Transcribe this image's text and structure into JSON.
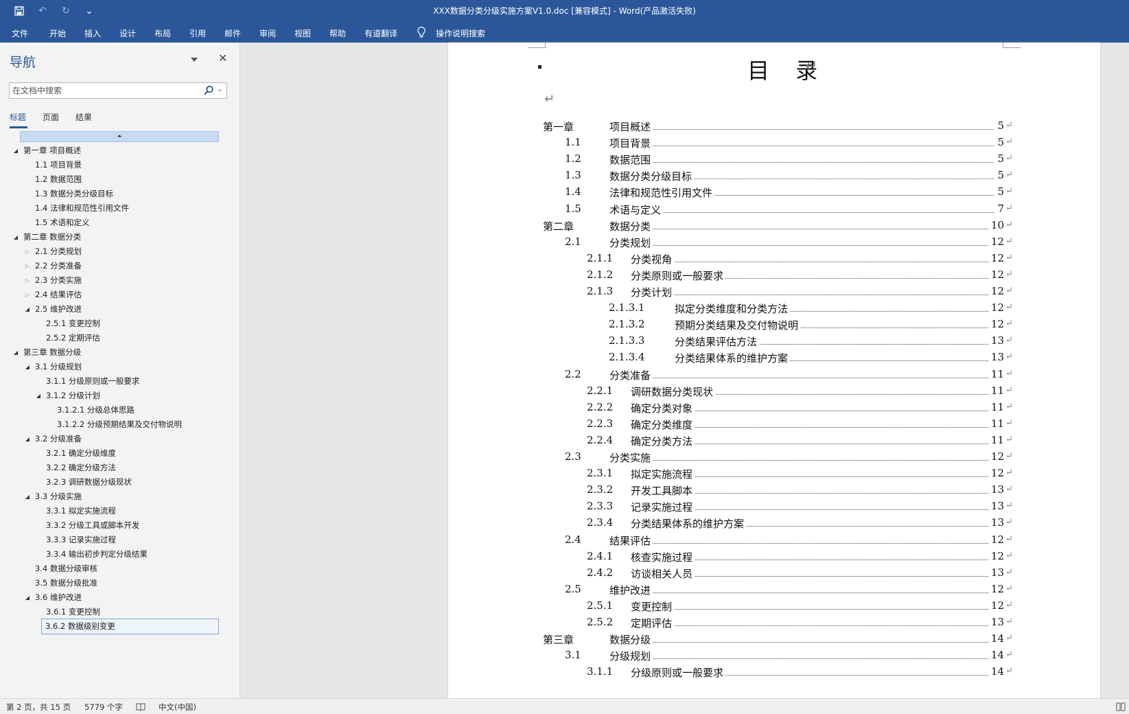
{
  "titlebar": {
    "title": "XXX数据分类分级实施方案V1.0.doc [兼容模式]  -  Word(产品激活失败)",
    "qat": {
      "save": "💾",
      "undo": "↶",
      "redo": "↻",
      "more": "⌄"
    }
  },
  "ribbon": {
    "tabs": [
      "文件",
      "开始",
      "插入",
      "设计",
      "布局",
      "引用",
      "邮件",
      "审阅",
      "视图",
      "帮助",
      "有道翻译"
    ],
    "tell_me": "操作说明搜索"
  },
  "nav": {
    "title": "导航",
    "close": "✕",
    "search_placeholder": "在文档中搜索",
    "tabs": [
      "标题",
      "页面",
      "结果"
    ],
    "collapse_glyph": "⏶",
    "items": [
      {
        "label": "第一章 项目概述",
        "level": 0,
        "toggle": "open"
      },
      {
        "label": "1.1 项目背景",
        "level": 1,
        "toggle": "none"
      },
      {
        "label": "1.2 数据范围",
        "level": 1,
        "toggle": "none"
      },
      {
        "label": "1.3 数据分类分级目标",
        "level": 1,
        "toggle": "none"
      },
      {
        "label": "1.4 法律和规范性引用文件",
        "level": 1,
        "toggle": "none"
      },
      {
        "label": "1.5 术语和定义",
        "level": 1,
        "toggle": "none"
      },
      {
        "label": "第二章 数据分类",
        "level": 0,
        "toggle": "open"
      },
      {
        "label": "2.1 分类规划",
        "level": 1,
        "toggle": "closed"
      },
      {
        "label": "2.2 分类准备",
        "level": 1,
        "toggle": "closed"
      },
      {
        "label": "2.3 分类实施",
        "level": 1,
        "toggle": "closed"
      },
      {
        "label": "2.4 结果评估",
        "level": 1,
        "toggle": "closed"
      },
      {
        "label": "2.5 维护改进",
        "level": 1,
        "toggle": "open"
      },
      {
        "label": "2.5.1 变更控制",
        "level": 2,
        "toggle": "none"
      },
      {
        "label": "2.5.2 定期评估",
        "level": 2,
        "toggle": "none"
      },
      {
        "label": "第三章 数据分级",
        "level": 0,
        "toggle": "open"
      },
      {
        "label": "3.1 分级规划",
        "level": 1,
        "toggle": "open"
      },
      {
        "label": "3.1.1 分级原则或一般要求",
        "level": 2,
        "toggle": "none"
      },
      {
        "label": "3.1.2 分级计划",
        "level": 2,
        "toggle": "open"
      },
      {
        "label": "3.1.2.1 分级总体思路",
        "level": 3,
        "toggle": "none"
      },
      {
        "label": "3.1.2.2 分级预期结果及交付物说明",
        "level": 3,
        "toggle": "none"
      },
      {
        "label": "3.2 分级准备",
        "level": 1,
        "toggle": "open"
      },
      {
        "label": "3.2.1 确定分级维度",
        "level": 2,
        "toggle": "none"
      },
      {
        "label": "3.2.2 确定分级方法",
        "level": 2,
        "toggle": "none"
      },
      {
        "label": "3.2.3 调研数据分级现状",
        "level": 2,
        "toggle": "none"
      },
      {
        "label": "3.3 分级实施",
        "level": 1,
        "toggle": "open"
      },
      {
        "label": "3.3.1 拟定实施流程",
        "level": 2,
        "toggle": "none"
      },
      {
        "label": "3.3.2 分级工具或脚本开发",
        "level": 2,
        "toggle": "none"
      },
      {
        "label": "3.3.3 记录实施过程",
        "level": 2,
        "toggle": "none"
      },
      {
        "label": "3.3.4 输出初步判定分级结果",
        "level": 2,
        "toggle": "none"
      },
      {
        "label": "3.4 数据分级审核",
        "level": 1,
        "toggle": "none"
      },
      {
        "label": "3.5 数据分级批准",
        "level": 1,
        "toggle": "none"
      },
      {
        "label": "3.6 维护改进",
        "level": 1,
        "toggle": "open"
      },
      {
        "label": "3.6.1 变更控制",
        "level": 2,
        "toggle": "none"
      },
      {
        "label": "3.6.2 数据级别变更",
        "level": 2,
        "toggle": "none",
        "selected": true
      }
    ]
  },
  "doc": {
    "title": "目 录",
    "para_mark": "↵",
    "toc": [
      {
        "num": "第一章",
        "title": "项目概述",
        "page": "5",
        "level": 0
      },
      {
        "num": "1.1",
        "title": "项目背景",
        "page": "5",
        "level": 1
      },
      {
        "num": "1.2",
        "title": "数据范围",
        "page": "5",
        "level": 1
      },
      {
        "num": "1.3",
        "title": "数据分类分级目标",
        "page": "5",
        "level": 1
      },
      {
        "num": "1.4",
        "title": "法律和规范性引用文件",
        "page": "5",
        "level": 1
      },
      {
        "num": "1.5",
        "title": "术语与定义",
        "page": "7",
        "level": 1
      },
      {
        "num": "第二章",
        "title": "数据分类",
        "page": "10",
        "level": 0
      },
      {
        "num": "2.1",
        "title": "分类规划",
        "page": "12",
        "level": 1
      },
      {
        "num": "2.1.1",
        "title": "分类视角",
        "page": "12",
        "level": 2
      },
      {
        "num": "2.1.2",
        "title": "分类原则或一般要求",
        "page": "12",
        "level": 2
      },
      {
        "num": "2.1.3",
        "title": "分类计划",
        "page": "12",
        "level": 2
      },
      {
        "num": "2.1.3.1",
        "title": "拟定分类维度和分类方法",
        "page": "12",
        "level": 3
      },
      {
        "num": "2.1.3.2",
        "title": "预期分类结果及交付物说明",
        "page": "12",
        "level": 3
      },
      {
        "num": "2.1.3.3",
        "title": "分类结果评估方法",
        "page": "13",
        "level": 3
      },
      {
        "num": "2.1.3.4",
        "title": "分类结果体系的维护方案",
        "page": "13",
        "level": 3
      },
      {
        "num": "2.2",
        "title": "分类准备",
        "page": "11",
        "level": 1
      },
      {
        "num": "2.2.1",
        "title": "调研数据分类现状",
        "page": "11",
        "level": 2
      },
      {
        "num": "2.2.2",
        "title": "确定分类对象",
        "page": "11",
        "level": 2
      },
      {
        "num": "2.2.3",
        "title": "确定分类维度",
        "page": "11",
        "level": 2
      },
      {
        "num": "2.2.4",
        "title": "确定分类方法",
        "page": "11",
        "level": 2
      },
      {
        "num": "2.3",
        "title": "分类实施",
        "page": "12",
        "level": 1
      },
      {
        "num": "2.3.1",
        "title": "拟定实施流程",
        "page": "12",
        "level": 2
      },
      {
        "num": "2.3.2",
        "title": "开发工具脚本",
        "page": "13",
        "level": 2
      },
      {
        "num": "2.3.3",
        "title": "记录实施过程",
        "page": "13",
        "level": 2
      },
      {
        "num": "2.3.4",
        "title": "分类结果体系的维护方案",
        "page": "13",
        "level": 2
      },
      {
        "num": "2.4",
        "title": "结果评估",
        "page": "12",
        "level": 1
      },
      {
        "num": "2.4.1",
        "title": "核查实施过程",
        "page": "12",
        "level": 2
      },
      {
        "num": "2.4.2",
        "title": "访谈相关人员",
        "page": "13",
        "level": 2
      },
      {
        "num": "2.5",
        "title": "维护改进",
        "page": "12",
        "level": 1
      },
      {
        "num": "2.5.1",
        "title": "变更控制",
        "page": "12",
        "level": 2
      },
      {
        "num": "2.5.2",
        "title": "定期评估",
        "page": "13",
        "level": 2
      },
      {
        "num": "第三章",
        "title": "数据分级",
        "page": "14",
        "level": 0
      },
      {
        "num": "3.1",
        "title": "分级规划",
        "page": "14",
        "level": 1
      },
      {
        "num": "3.1.1",
        "title": "分级原则或一般要求",
        "page": "14",
        "level": 2
      }
    ]
  },
  "status": {
    "page": "第 2 页，共 15 页",
    "words": "5779 个字",
    "language": "中文(中国)"
  }
}
